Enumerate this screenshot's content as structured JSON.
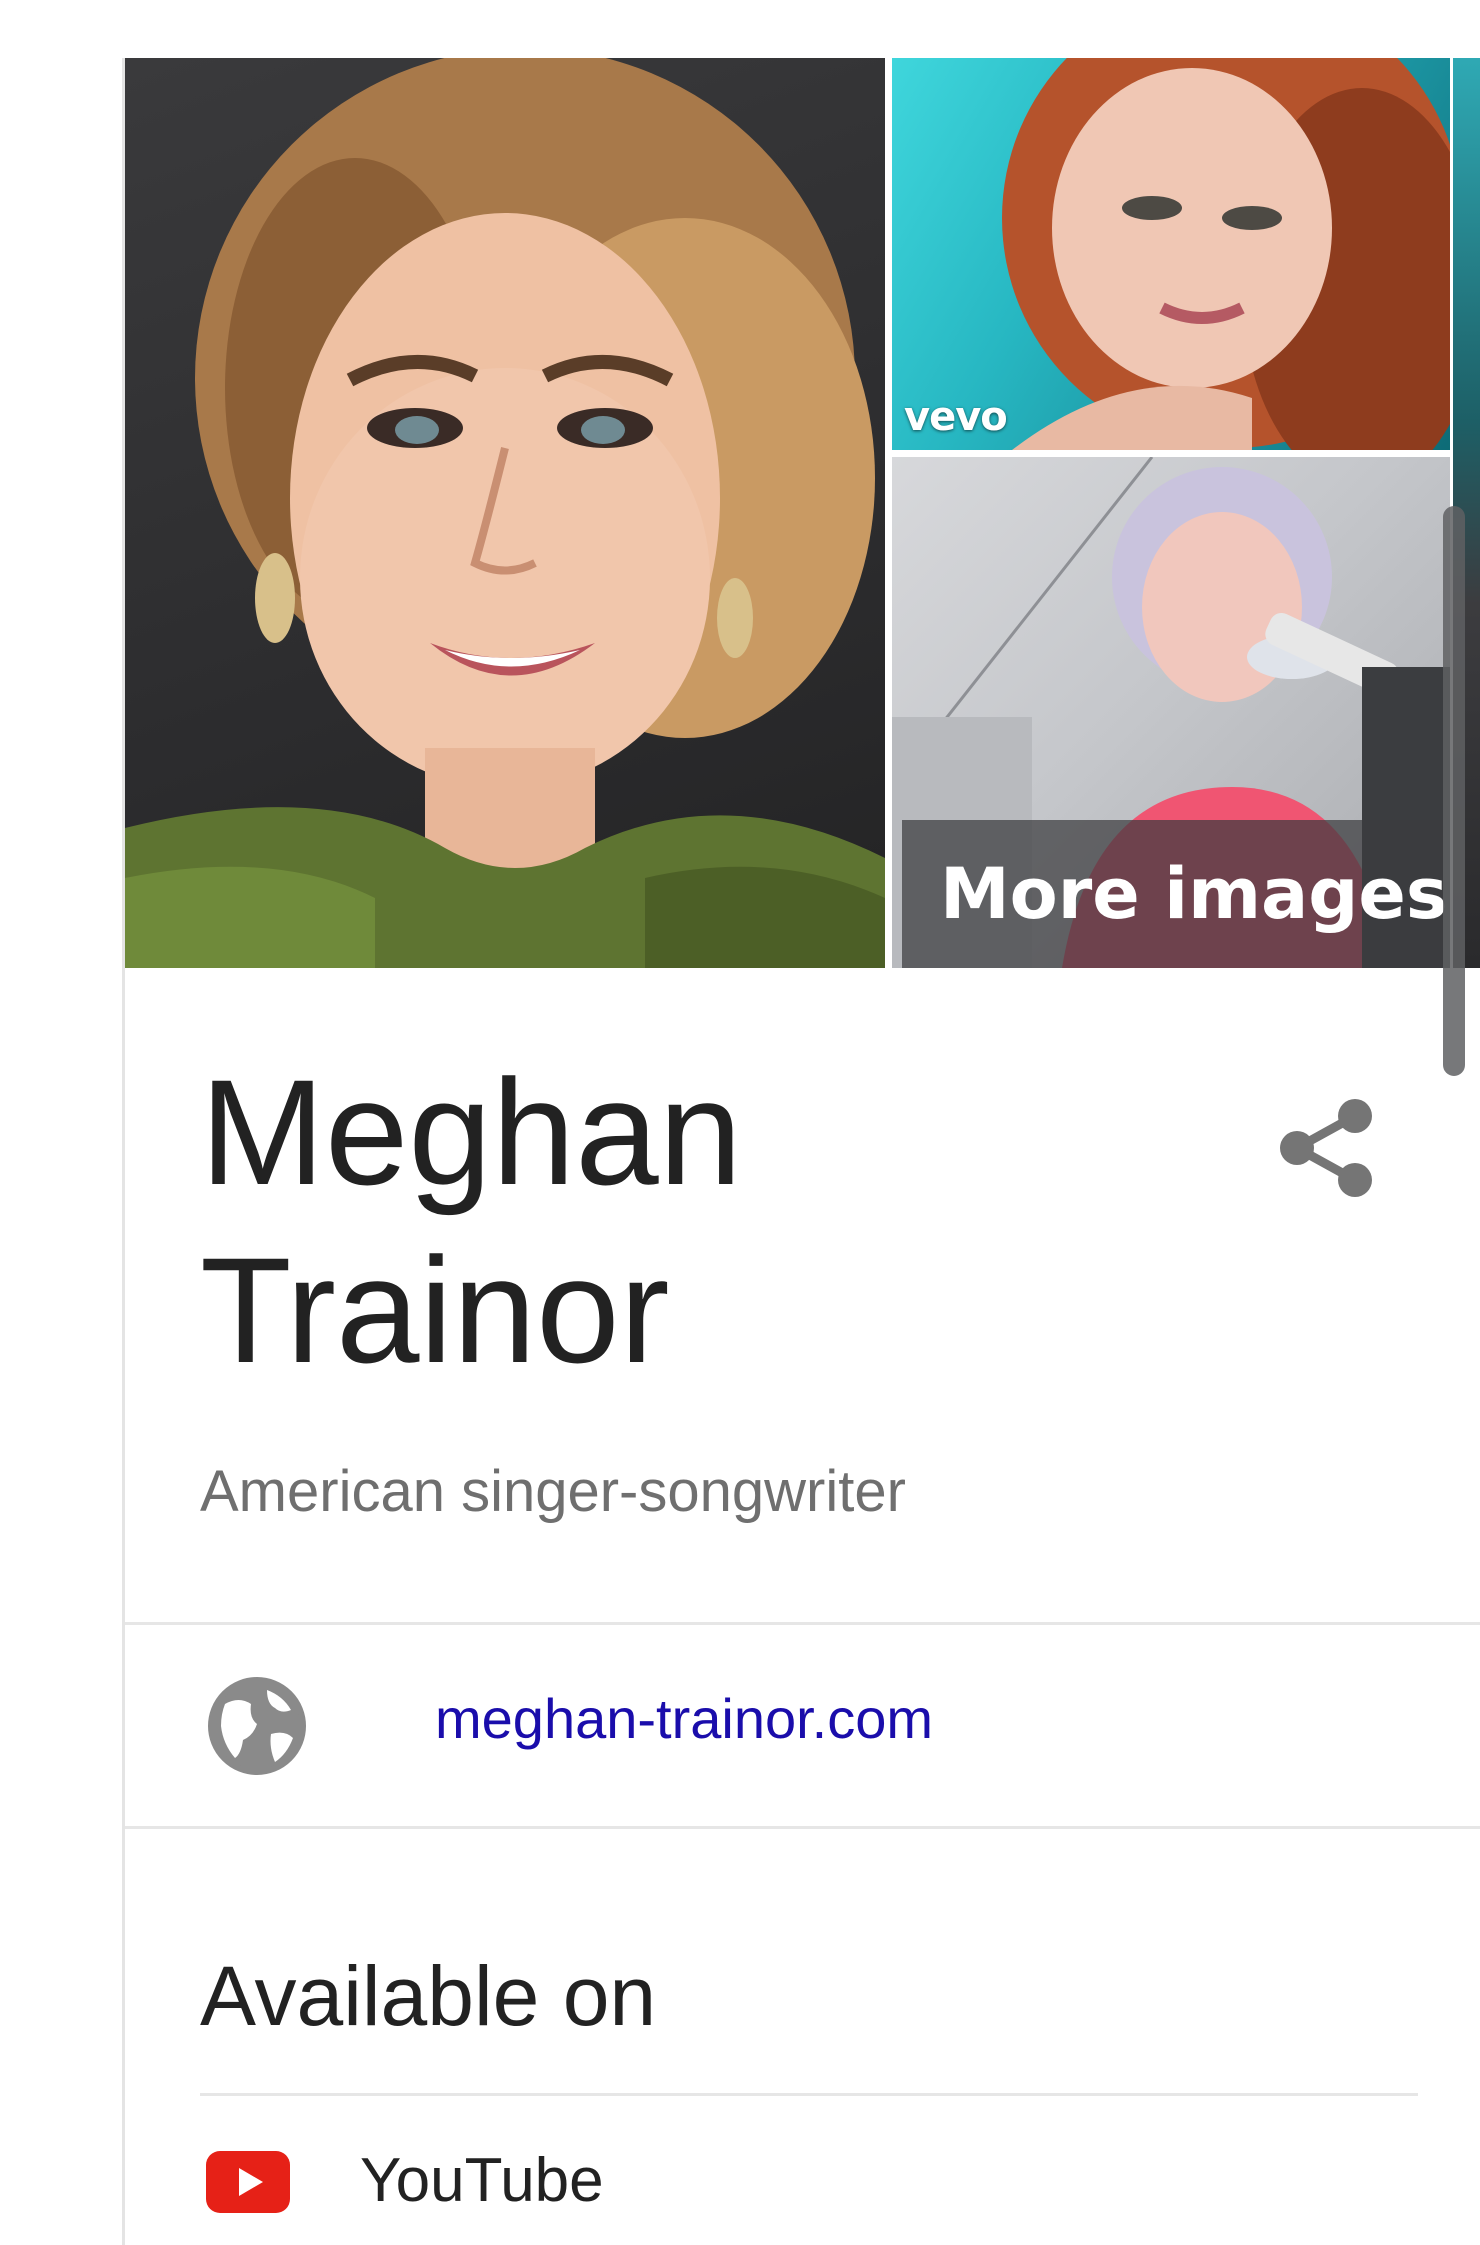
{
  "knowledge_panel": {
    "images": {
      "top_watermark": "vevo",
      "more_images_label": "More images"
    },
    "title": "Meghan Trainor",
    "subtitle": "American singer-songwriter",
    "website": {
      "icon": "globe-icon",
      "label": "meghan-trainor.com"
    },
    "available_on": {
      "heading": "Available on",
      "items": [
        {
          "icon": "youtube-icon",
          "label": "YouTube"
        }
      ]
    },
    "share_icon": "share-icon"
  },
  "colors": {
    "link": "#1a0dab",
    "title": "#222222",
    "subtitle": "#6f6f6f",
    "youtube_red": "#e62117",
    "icon_gray": "#757575",
    "divider": "#e6e6e6"
  }
}
